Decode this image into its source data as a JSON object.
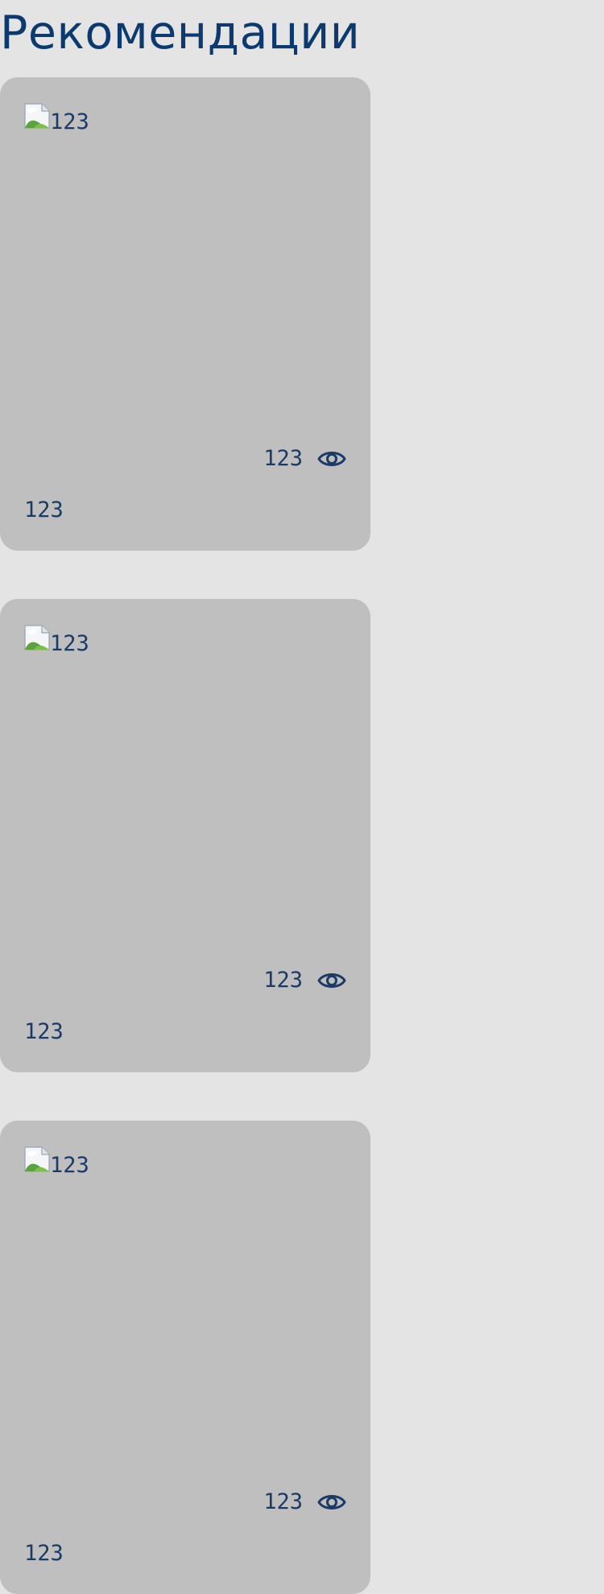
{
  "page": {
    "title": "Рекомендации"
  },
  "cards": [
    {
      "image_alt": "123",
      "views": "123",
      "caption": "123"
    },
    {
      "image_alt": "123",
      "views": "123",
      "caption": "123"
    },
    {
      "image_alt": "123",
      "views": "123",
      "caption": "123"
    }
  ],
  "icons": {
    "broken_image": "broken-image-icon",
    "views": "eye-icon"
  },
  "colors": {
    "background": "#e4e4e4",
    "card": "#bfbfbf",
    "text": "#1b3a66",
    "title": "#0d3a6e"
  }
}
